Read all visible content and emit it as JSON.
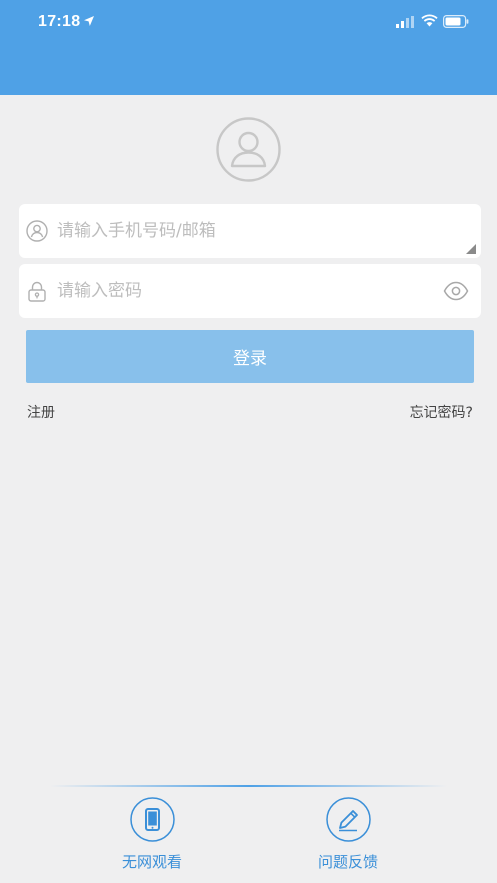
{
  "status_bar": {
    "time": "17:18"
  },
  "icons": {
    "location": "location-arrow-icon",
    "signal": "cellular-signal-icon",
    "wifi": "wifi-icon",
    "battery": "battery-icon",
    "avatar": "user-avatar-icon",
    "user": "user-icon",
    "lock": "lock-icon",
    "eye": "eye-icon",
    "phone": "phone-icon",
    "pencil": "pencil-icon"
  },
  "colors": {
    "header": "#4fa1e6",
    "background": "#efeff0",
    "login_button": "#88c0eb",
    "accent_text": "#3a8fd8"
  },
  "form": {
    "phone_placeholder": "请输入手机号码/邮箱",
    "phone_value": "",
    "password_placeholder": "请输入密码",
    "password_value": ""
  },
  "login_button": "登录",
  "links": {
    "register": "注册",
    "forgot": "忘记密码?"
  },
  "bottom": {
    "offline": "无网观看",
    "feedback": "问题反馈"
  }
}
